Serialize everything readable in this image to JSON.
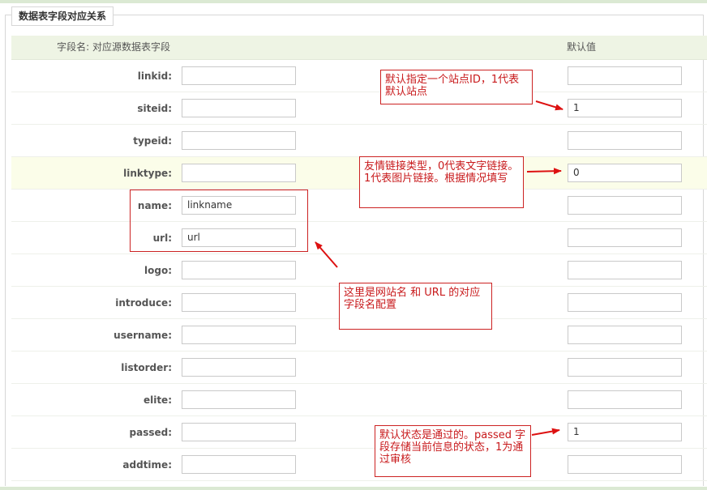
{
  "legend": "数据表字段对应关系",
  "header": {
    "name_col": "字段名: 对应源数据表字段",
    "default_col": "默认值"
  },
  "rows": [
    {
      "label": "linkid:",
      "field": "",
      "default": ""
    },
    {
      "label": "siteid:",
      "field": "",
      "default": "1"
    },
    {
      "label": "typeid:",
      "field": "",
      "default": ""
    },
    {
      "label": "linktype:",
      "field": "",
      "default": "0"
    },
    {
      "label": "name:",
      "field": "linkname",
      "default": ""
    },
    {
      "label": "url:",
      "field": "url",
      "default": ""
    },
    {
      "label": "logo:",
      "field": "",
      "default": ""
    },
    {
      "label": "introduce:",
      "field": "",
      "default": ""
    },
    {
      "label": "username:",
      "field": "",
      "default": ""
    },
    {
      "label": "listorder:",
      "field": "",
      "default": ""
    },
    {
      "label": "elite:",
      "field": "",
      "default": ""
    },
    {
      "label": "passed:",
      "field": "",
      "default": "1"
    },
    {
      "label": "addtime:",
      "field": "",
      "default": ""
    }
  ],
  "annotations": {
    "siteid": "默认指定一个站点ID，1代表默认站点",
    "linktype": "友情链接类型，0代表文字链接。1代表图片链接。根据情况填写",
    "name_url": "这里是网站名 和 URL 的对应字段名配置",
    "passed": "默认状态是通过的。passed 字段存储当前信息的状态，1为通过审核"
  },
  "colors": {
    "annotation_red": "#cc2222",
    "header_bg": "#eef4e4",
    "highlight_row_bg": "#fbfde9"
  }
}
